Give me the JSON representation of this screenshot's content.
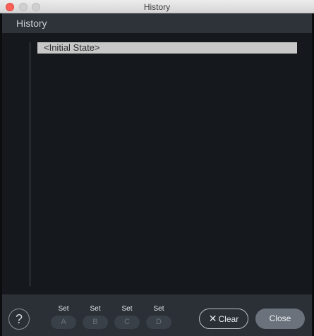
{
  "window": {
    "title": "History"
  },
  "header": {
    "title": "History"
  },
  "history": {
    "items": [
      {
        "label": "<Initial State>"
      }
    ]
  },
  "footer": {
    "help_label": "?",
    "sets": [
      {
        "top": "Set",
        "slot": "A"
      },
      {
        "top": "Set",
        "slot": "B"
      },
      {
        "top": "Set",
        "slot": "C"
      },
      {
        "top": "Set",
        "slot": "D"
      }
    ],
    "clear_icon": "✕",
    "clear_label": "Clear",
    "close_label": "Close"
  },
  "colors": {
    "titlebar": "#e0e0e0",
    "header_bg": "#2e333a",
    "list_bg": "#15181c",
    "selected_item_bg": "#c8c8c8",
    "footer_bg": "#2b3037",
    "close_button_bg": "#6b727b",
    "traffic_red": "#fc5f57"
  }
}
